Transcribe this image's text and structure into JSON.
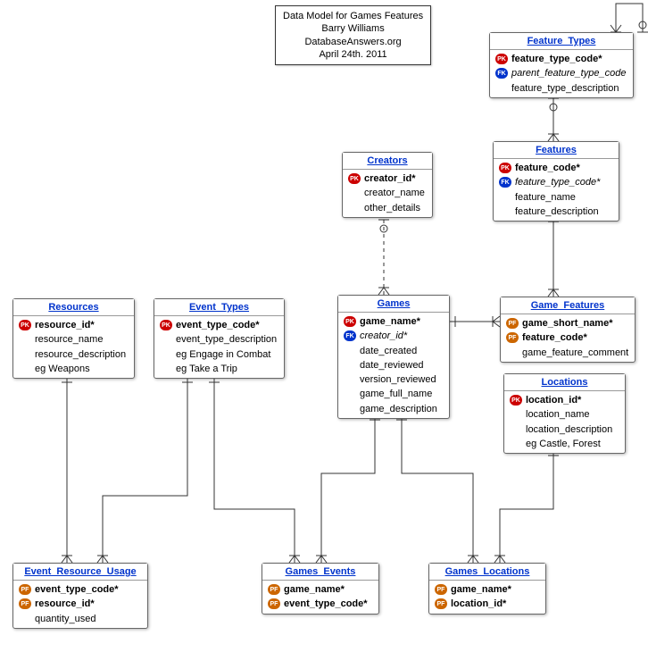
{
  "title_box": {
    "line1": "Data Model for Games Features",
    "line2": "Barry Williams",
    "line3": "DatabaseAnswers.org",
    "line4": "April 24th. 2011"
  },
  "entities": {
    "feature_types": {
      "title": "Feature_Types",
      "attrs": [
        {
          "key": "PK",
          "name": "feature_type_code*",
          "bold": true
        },
        {
          "key": "FK",
          "name": "parent_feature_type_code",
          "italic": true
        },
        {
          "key": "",
          "name": "feature_type_description"
        }
      ]
    },
    "features": {
      "title": "Features",
      "attrs": [
        {
          "key": "PK",
          "name": "feature_code*",
          "bold": true
        },
        {
          "key": "FK",
          "name": "feature_type_code*",
          "italic": true
        },
        {
          "key": "",
          "name": "feature_name"
        },
        {
          "key": "",
          "name": "feature_description"
        }
      ]
    },
    "creators": {
      "title": "Creators",
      "attrs": [
        {
          "key": "PK",
          "name": "creator_id*",
          "bold": true
        },
        {
          "key": "",
          "name": "creator_name"
        },
        {
          "key": "",
          "name": "other_details"
        }
      ]
    },
    "games": {
      "title": "Games",
      "attrs": [
        {
          "key": "PK",
          "name": "game_name*",
          "bold": true
        },
        {
          "key": "FK",
          "name": "creator_id*",
          "italic": true
        },
        {
          "key": "",
          "name": "date_created"
        },
        {
          "key": "",
          "name": "date_reviewed"
        },
        {
          "key": "",
          "name": "version_reviewed"
        },
        {
          "key": "",
          "name": "game_full_name"
        },
        {
          "key": "",
          "name": "game_description"
        }
      ]
    },
    "game_features": {
      "title": "Game_Features",
      "attrs": [
        {
          "key": "PF",
          "name": "game_short_name*",
          "bold": true
        },
        {
          "key": "PF",
          "name": "feature_code*",
          "bold": true
        },
        {
          "key": "",
          "name": "game_feature_comment"
        }
      ]
    },
    "locations": {
      "title": "Locations",
      "attrs": [
        {
          "key": "PK",
          "name": "location_id*",
          "bold": true
        },
        {
          "key": "",
          "name": "location_name"
        },
        {
          "key": "",
          "name": "location_description"
        },
        {
          "key": "",
          "name": "eg Castle, Forest"
        }
      ]
    },
    "resources": {
      "title": "Resources",
      "attrs": [
        {
          "key": "PK",
          "name": "resource_id*",
          "bold": true
        },
        {
          "key": "",
          "name": "resource_name"
        },
        {
          "key": "",
          "name": "resource_description"
        },
        {
          "key": "",
          "name": "eg Weapons"
        }
      ]
    },
    "event_types": {
      "title": "Event_Types",
      "attrs": [
        {
          "key": "PK",
          "name": "event_type_code*",
          "bold": true
        },
        {
          "key": "",
          "name": "event_type_description"
        },
        {
          "key": "",
          "name": "eg Engage in Combat"
        },
        {
          "key": "",
          "name": "eg Take a Trip"
        }
      ]
    },
    "event_resource_usage": {
      "title": "Event_Resource_Usage",
      "attrs": [
        {
          "key": "PF",
          "name": "event_type_code*",
          "bold": true
        },
        {
          "key": "PF",
          "name": "resource_id*",
          "bold": true
        },
        {
          "key": "",
          "name": "quantity_used"
        }
      ]
    },
    "games_events": {
      "title": "Games_Events",
      "attrs": [
        {
          "key": "PF",
          "name": "game_name*",
          "bold": true
        },
        {
          "key": "PF",
          "name": "event_type_code*",
          "bold": true
        }
      ]
    },
    "games_locations": {
      "title": "Games_Locations",
      "attrs": [
        {
          "key": "PF",
          "name": "game_name*",
          "bold": true
        },
        {
          "key": "PF",
          "name": "location_id*",
          "bold": true
        }
      ]
    }
  }
}
